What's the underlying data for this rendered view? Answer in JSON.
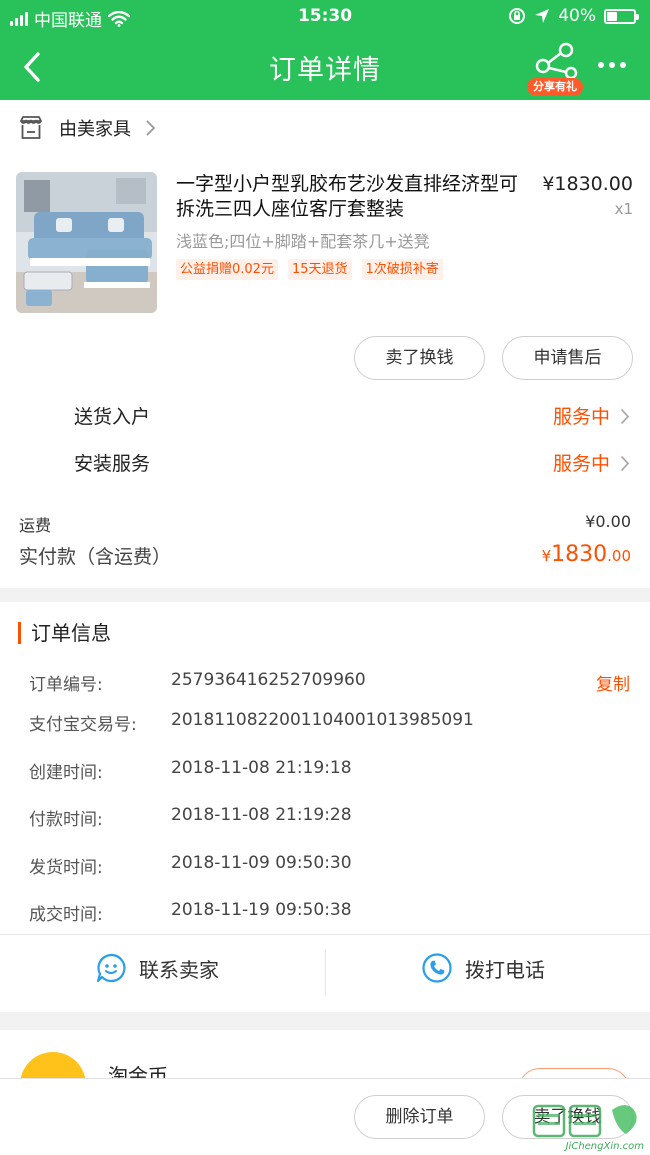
{
  "status_bar": {
    "carrier": "中国联通",
    "time": "15:30",
    "battery_percent": "40%",
    "battery_level": 0.4
  },
  "nav": {
    "title": "订单详情",
    "share_badge": "分享有礼"
  },
  "shop": {
    "name": "由美家具"
  },
  "product": {
    "title": "一字型小户型乳胶布艺沙发直排经济型可拆洗三四人座位客厅套整装",
    "price": "¥1830.00",
    "qty": "x1",
    "sku": "浅蓝色;四位+脚踏+配套茶几+送凳",
    "tags": [
      "公益捐赠0.02元",
      "15天退货",
      "1次破损补寄"
    ]
  },
  "item_actions": {
    "sell": "卖了换钱",
    "after_sale": "申请售后"
  },
  "services": [
    {
      "label": "送货入户",
      "status": "服务中"
    },
    {
      "label": "安装服务",
      "status": "服务中"
    }
  ],
  "fees": {
    "shipping_label": "运费",
    "shipping_value": "¥0.00",
    "paid_label": "实付款（含运费）",
    "paid_currency": "¥",
    "paid_int": "1830",
    "paid_dec": ".00"
  },
  "order_info": {
    "title": "订单信息",
    "copy_label": "复制",
    "rows": [
      {
        "label": "订单编号:",
        "value": "257936416252709960"
      },
      {
        "label": "支付宝交易号:",
        "value": "2018110822001104001013985091"
      },
      {
        "label": "创建时间:",
        "value": "2018-11-08 21:19:18"
      },
      {
        "label": "付款时间:",
        "value": "2018-11-08 21:19:28"
      },
      {
        "label": "发货时间:",
        "value": "2018-11-09 09:50:30"
      },
      {
        "label": "成交时间:",
        "value": "2018-11-19 09:50:38"
      }
    ],
    "contact_seller": "联系卖家",
    "call_phone": "拨打电话"
  },
  "coin": {
    "title": "淘金币"
  },
  "bottom": {
    "delete": "删除订单",
    "sell": "卖了换钱"
  },
  "watermark": {
    "text": "JiChengXin.com"
  },
  "colors": {
    "green": "#29c25a",
    "orange": "#ff5000",
    "tag_bg": "#fff1ea"
  }
}
